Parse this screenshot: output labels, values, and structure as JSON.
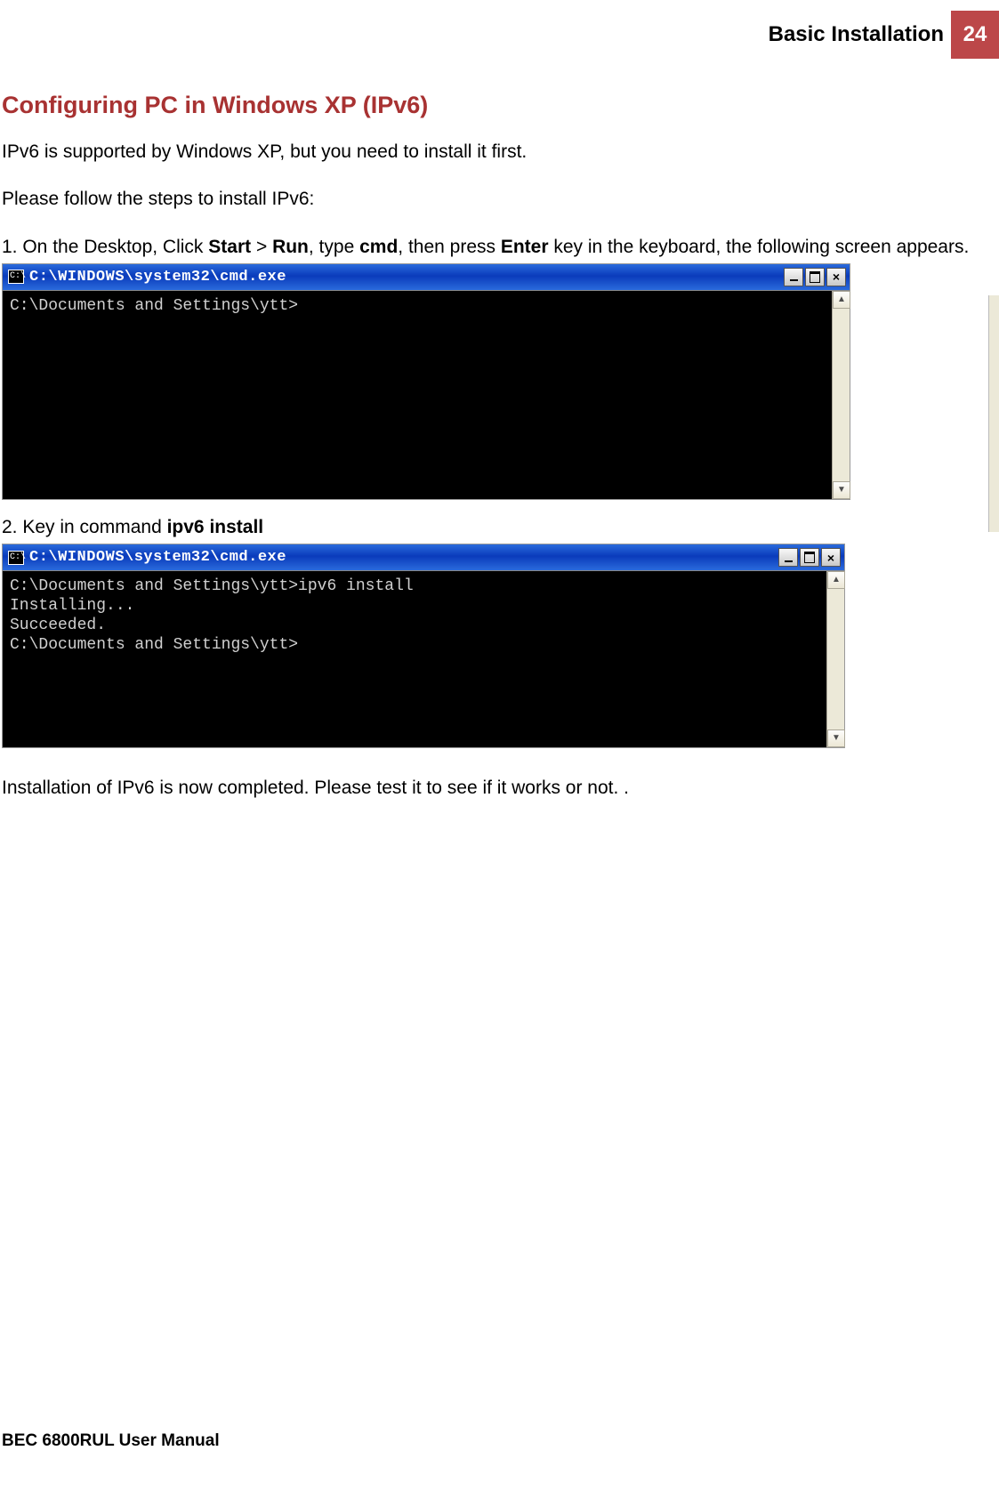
{
  "header": {
    "section": "Basic Installation",
    "page_number": "24"
  },
  "title": "Configuring PC in Windows XP (IPv6)",
  "intro": "IPv6 is supported by Windows XP, but you need to install it first.",
  "please_follow": "Please follow the steps to install IPv6:",
  "step1": {
    "prefix": "1. On the Desktop, Click ",
    "start": "Start",
    "gt": " > ",
    "run": "Run",
    "type": ", type ",
    "cmd": "cmd",
    "then": ", then press ",
    "enter": "Enter",
    "suffix": " key in the keyboard, the following screen appears."
  },
  "step2": {
    "prefix": "2. Key in command ",
    "command": "ipv6 install"
  },
  "completion": "Installation of IPv6 is now completed.  Please test it to see if it works or not. .",
  "terminal1": {
    "title": "C:\\WINDOWS\\system32\\cmd.exe",
    "lines": [
      "C:\\Documents and Settings\\ytt>"
    ]
  },
  "terminal2": {
    "title": "C:\\WINDOWS\\system32\\cmd.exe",
    "lines": [
      "C:\\Documents and Settings\\ytt>ipv6 install",
      "Installing...",
      "Succeeded.",
      "",
      "C:\\Documents and Settings\\ytt>"
    ]
  },
  "footer": "BEC 6800RUL User Manual",
  "icons": {
    "cmd_glyph": "C:\\"
  }
}
